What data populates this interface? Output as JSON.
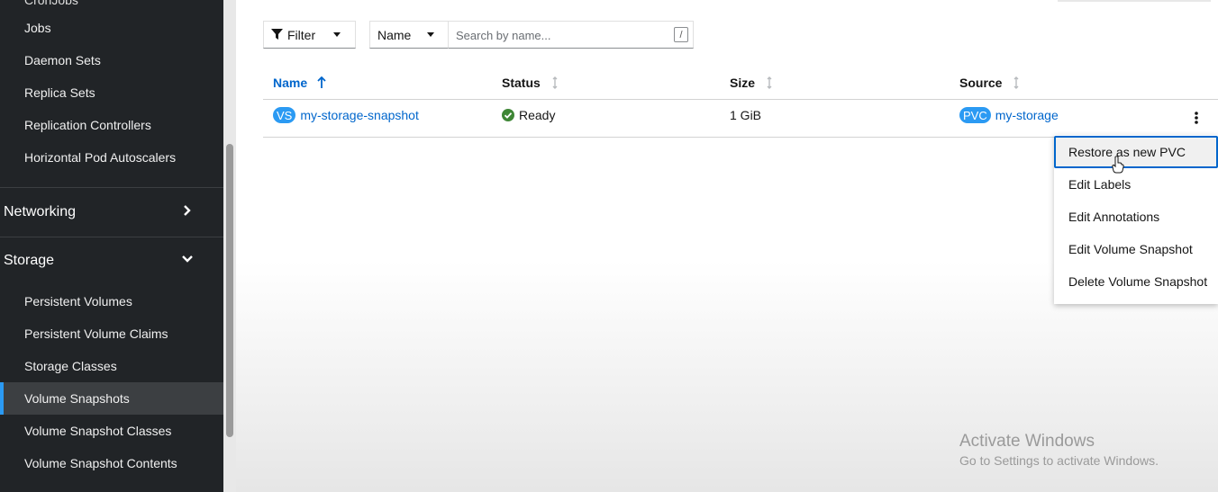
{
  "sidebar": {
    "cutoff_label": "CronJobs",
    "workloads_items": [
      {
        "label": "Jobs"
      },
      {
        "label": "Daemon Sets"
      },
      {
        "label": "Replica Sets"
      },
      {
        "label": "Replication Controllers"
      },
      {
        "label": "Horizontal Pod Autoscalers"
      }
    ],
    "networking": {
      "label": "Networking",
      "icon": "chevron-right-icon"
    },
    "storage": {
      "label": "Storage",
      "icon": "chevron-down-icon"
    },
    "storage_items": [
      {
        "label": "Persistent Volumes"
      },
      {
        "label": "Persistent Volume Claims"
      },
      {
        "label": "Storage Classes"
      },
      {
        "label": "Volume Snapshots",
        "active": true
      },
      {
        "label": "Volume Snapshot Classes"
      },
      {
        "label": "Volume Snapshot Contents"
      }
    ]
  },
  "toolbar": {
    "filter_label": "Filter",
    "name_select": "Name",
    "search_placeholder": "Search by name...",
    "search_shortcut": "/"
  },
  "table": {
    "columns": [
      {
        "label": "Name",
        "sorted": "asc"
      },
      {
        "label": "Status"
      },
      {
        "label": "Size"
      },
      {
        "label": "Source"
      }
    ],
    "rows": [
      {
        "name_badge": "VS",
        "name": "my-storage-snapshot",
        "status": "Ready",
        "size": "1 GiB",
        "source_badge": "PVC",
        "source": "my-storage"
      }
    ]
  },
  "actions_menu": {
    "items": [
      {
        "label": "Restore as new PVC",
        "focused": true
      },
      {
        "label": "Edit Labels"
      },
      {
        "label": "Edit Annotations"
      },
      {
        "label": "Edit Volume Snapshot"
      },
      {
        "label": "Delete Volume Snapshot"
      }
    ]
  },
  "watermark": {
    "title": "Activate Windows",
    "subtitle": "Go to Settings to activate Windows."
  },
  "colors": {
    "sidebar_bg": "#212427",
    "accent": "#0066cc",
    "badge": "#2b9af3",
    "success": "#3e8635"
  }
}
